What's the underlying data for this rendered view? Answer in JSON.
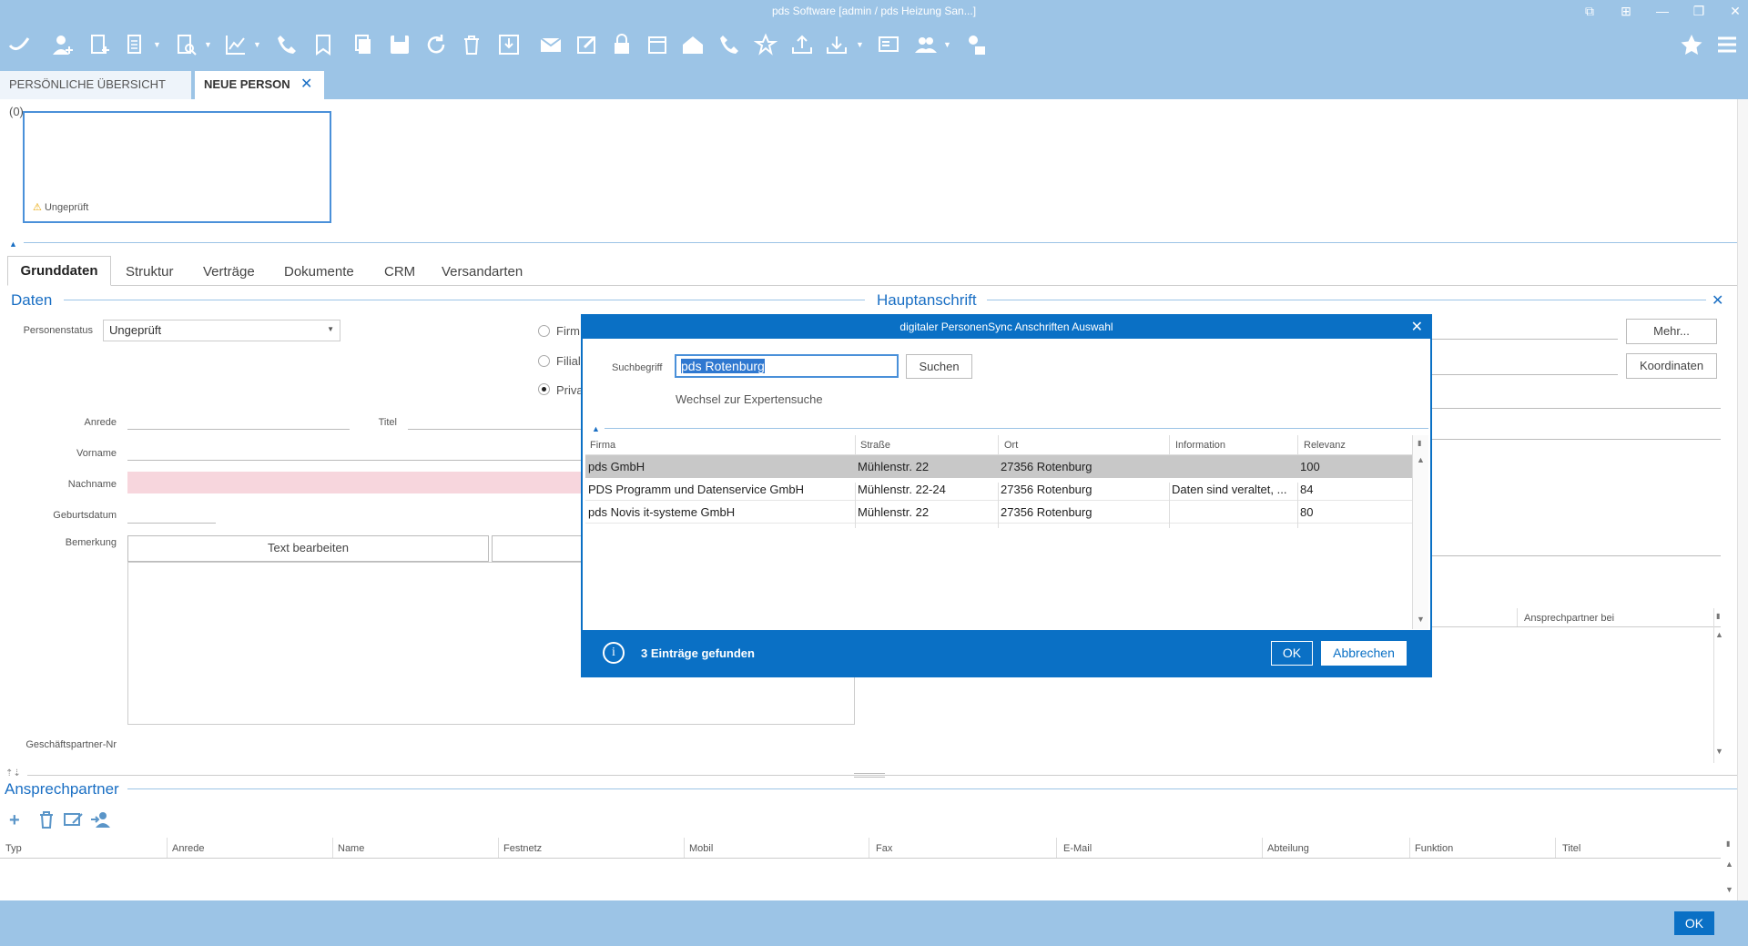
{
  "window": {
    "title": "pds Software [admin / pds Heizung San...]"
  },
  "tabs": {
    "overview": "PERSÖNLICHE ÜBERSICHT (0)",
    "new_person": "NEUE PERSON"
  },
  "photo": {
    "status": "Ungeprüft"
  },
  "subtabs": [
    "Grunddaten",
    "Struktur",
    "Verträge",
    "Dokumente",
    "CRM",
    "Versandarten"
  ],
  "sections": {
    "daten": "Daten",
    "hauptanschrift": "Hauptanschrift",
    "ansprechpartner": "Ansprechpartner"
  },
  "form": {
    "personenstatus_label": "Personenstatus",
    "personenstatus_value": "Ungeprüft",
    "radio_firma": "Firm",
    "radio_filiale": "Filial",
    "radio_privat": "Priva",
    "anrede_label": "Anrede",
    "titel_label": "Titel",
    "vorname_label": "Vorname",
    "nachname_label": "Nachname",
    "geburtsdatum_label": "Geburtsdatum",
    "bemerkung_label": "Bemerkung",
    "text_bearbeiten": "Text bearbeiten",
    "geschaeftspartner_label": "Geschäftspartner-Nr",
    "mehr_button": "Mehr...",
    "koordinaten_button": "Koordinaten",
    "ansprechpartner_bei": "Ansprechpartner bei"
  },
  "contacts_table": {
    "columns": [
      "Typ",
      "Anrede",
      "Name",
      "Festnetz",
      "Mobil",
      "Fax",
      "E-Mail",
      "Abteilung",
      "Funktion",
      "Titel"
    ]
  },
  "dialog": {
    "title": "digitaler PersonenSync Anschriften Auswahl",
    "search_label": "Suchbegriff",
    "search_value": "pds Rotenburg",
    "search_button": "Suchen",
    "expert_link": "Wechsel zur Expertensuche",
    "columns": [
      "Firma",
      "Straße",
      "Ort",
      "Information",
      "Relevanz"
    ],
    "rows": [
      {
        "firma": "pds GmbH",
        "strasse": "Mühlenstr. 22",
        "ort": "27356 Rotenburg",
        "info": "",
        "relevanz": "100"
      },
      {
        "firma": "PDS Programm und Datenservice GmbH",
        "strasse": "Mühlenstr. 22-24",
        "ort": "27356 Rotenburg",
        "info": "Daten sind veraltet, ...",
        "relevanz": "84"
      },
      {
        "firma": "pds Novis it-systeme GmbH",
        "strasse": "Mühlenstr. 22",
        "ort": "27356 Rotenburg",
        "info": "",
        "relevanz": "80"
      }
    ],
    "status": "3 Einträge gefunden",
    "ok": "OK",
    "cancel": "Abbrechen"
  },
  "footer": {
    "ok": "OK"
  },
  "colors": {
    "toolbar": "#9cc4e6",
    "accent": "#0a70c5",
    "selected_row": "#c8c8c8",
    "required_field": "#f7d6dd"
  }
}
